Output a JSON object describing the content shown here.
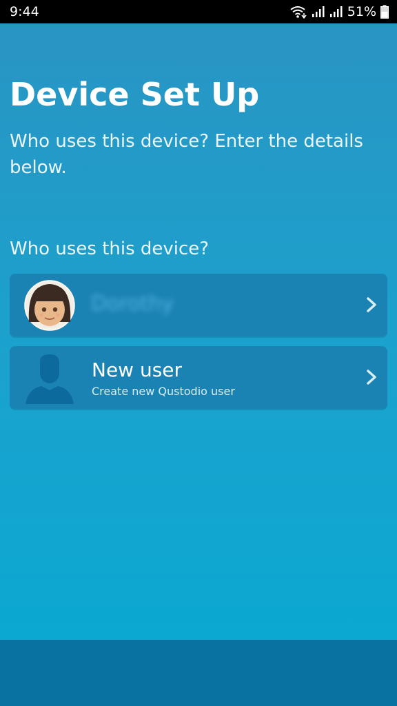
{
  "status_bar": {
    "time": "9:44",
    "battery": "51%"
  },
  "page": {
    "title": "Device Set Up",
    "subtitle": "Who uses this device? Enter the details below.",
    "section_label": "Who uses this device?"
  },
  "users": [
    {
      "name": "Dorothy",
      "avatar_icon": "girl-avatar-icon"
    },
    {
      "name": "New user",
      "subtitle": "Create new Qustodio user",
      "avatar_icon": "person-silhouette-icon"
    }
  ],
  "colors": {
    "card_bg": "#1b83b3",
    "bottom_bar": "#0a72a0",
    "status_bar": "#000000"
  }
}
